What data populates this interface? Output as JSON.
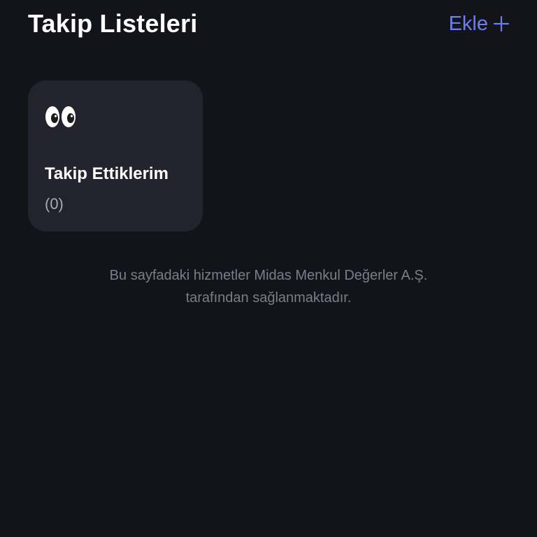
{
  "header": {
    "title": "Takip Listeleri",
    "add_label": "Ekle",
    "add_icon": "plus-icon",
    "accent_color": "#6b7ff0"
  },
  "watchlists": [
    {
      "icon": "eyes-emoji",
      "title": "Takip Ettiklerim",
      "count": "(0)"
    }
  ],
  "footer": {
    "disclaimer_line1": "Bu sayfadaki hizmetler Midas Menkul Değerler A.Ş.",
    "disclaimer_line2": "tarafından sağlanmaktadır."
  }
}
